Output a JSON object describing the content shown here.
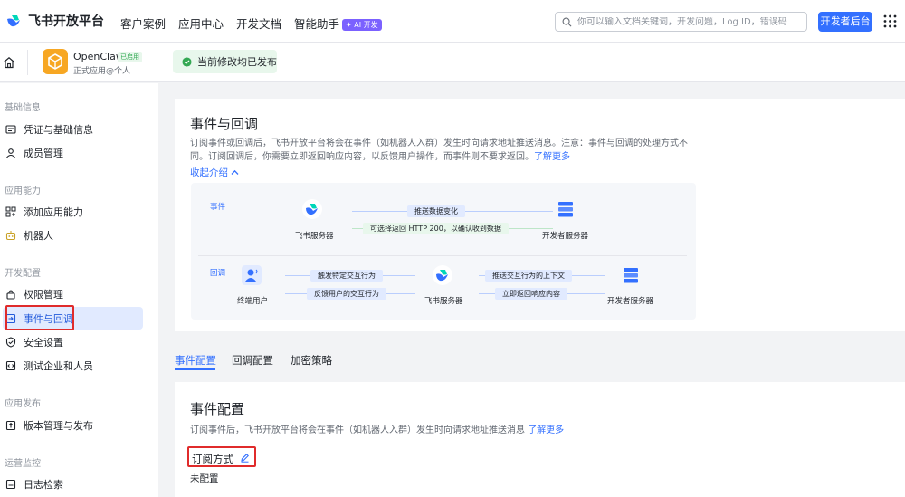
{
  "topbar": {
    "brand": "飞书开放平台",
    "nav": [
      "客户案例",
      "应用中心",
      "开发文档",
      "智能助手"
    ],
    "ai_badge": "✦ AI 开发",
    "search_placeholder": "你可以输入文档关键词，开发问题，Log ID，错误码",
    "dev_console_button": "开发者后台"
  },
  "appbar": {
    "app_name": "OpenClaw",
    "app_status": "已启用",
    "app_type": "正式应用@个人",
    "publish_status": "当前修改均已发布"
  },
  "sidebar": {
    "sections": [
      {
        "title": "基础信息",
        "items": [
          {
            "label": "凭证与基础信息",
            "icon": "credentials-icon"
          },
          {
            "label": "成员管理",
            "icon": "user-icon"
          }
        ]
      },
      {
        "title": "应用能力",
        "items": [
          {
            "label": "添加应用能力",
            "icon": "apps-icon"
          },
          {
            "label": "机器人",
            "icon": "robot-icon"
          }
        ]
      },
      {
        "title": "开发配置",
        "items": [
          {
            "label": "权限管理",
            "icon": "lock-icon"
          },
          {
            "label": "事件与回调",
            "icon": "event-icon",
            "active": true
          },
          {
            "label": "安全设置",
            "icon": "shield-icon"
          },
          {
            "label": "测试企业和人员",
            "icon": "test-icon"
          }
        ]
      },
      {
        "title": "应用发布",
        "items": [
          {
            "label": "版本管理与发布",
            "icon": "upload-icon"
          }
        ]
      },
      {
        "title": "运营监控",
        "items": [
          {
            "label": "日志检索",
            "icon": "log-icon"
          }
        ]
      }
    ]
  },
  "main": {
    "title": "事件与回调",
    "description_line1": "订阅事件或回调后，飞书开放平台将会在事件（如机器人入群）发生时向请求地址推送消息。注意：事件与回调的处理方式不",
    "description_line2": "同。订阅回调后，你需要立即返回响应内容，以反馈用户操作，而事件则不要求返回。",
    "learn_more": "了解更多",
    "collapse": "收起介绍",
    "diagram": {
      "event_tag": "事件",
      "callback_tag": "回调",
      "feishu_server": "飞书服务器",
      "dev_server": "开发者服务器",
      "end_user": "终端用户",
      "push_data_change": "推送数据变化",
      "optional_return": "可选择返回 HTTP 200，以确认收到数据",
      "trigger_action": "触发特定交互行为",
      "feedback_action": "反馈用户的交互行为",
      "push_context": "推送交互行为的上下文",
      "return_immediately": "立即返回响应内容"
    },
    "tabs": [
      "事件配置",
      "回调配置",
      "加密策略"
    ],
    "event_config": {
      "title": "事件配置",
      "description": "订阅事件后，飞书开放平台将会在事件（如机器人入群）发生时向请求地址推送消息",
      "learn_more": "了解更多",
      "subscription_mode": "订阅方式",
      "status": "未配置"
    }
  },
  "colors": {
    "accent": "#3370ff",
    "success": "#34a853",
    "highlight": "#e02b2b",
    "app_icon": "#f7a723"
  }
}
